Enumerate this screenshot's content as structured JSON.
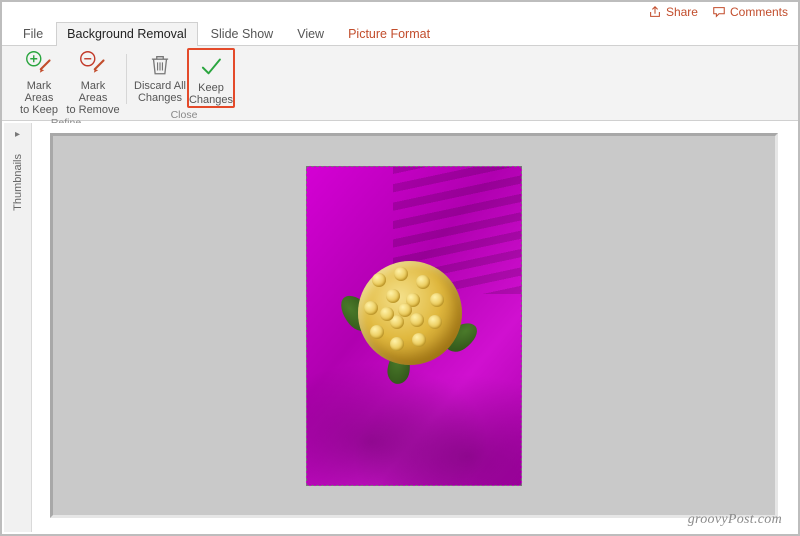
{
  "title_actions": {
    "share": "Share",
    "comments": "Comments"
  },
  "tabs": {
    "file": "File",
    "bgremoval": "Background Removal",
    "slideshow": "Slide Show",
    "view": "View",
    "picfmt": "Picture Format"
  },
  "ribbon": {
    "refine": {
      "mark_keep_l1": "Mark Areas",
      "mark_keep_l2": "to Keep",
      "mark_remove_l1": "Mark Areas",
      "mark_remove_l2": "to Remove",
      "group_label": "Refine"
    },
    "close": {
      "discard_l1": "Discard All",
      "discard_l2": "Changes",
      "keep_l1": "Keep",
      "keep_l2": "Changes",
      "group_label": "Close"
    }
  },
  "panel": {
    "thumbnails_label": "Thumbnails"
  },
  "watermark": "groovyPost.com",
  "colors": {
    "accent": "#c24d2c",
    "bg_removal_tint": "#cc00cc",
    "highlight_box": "#e44a2a"
  }
}
